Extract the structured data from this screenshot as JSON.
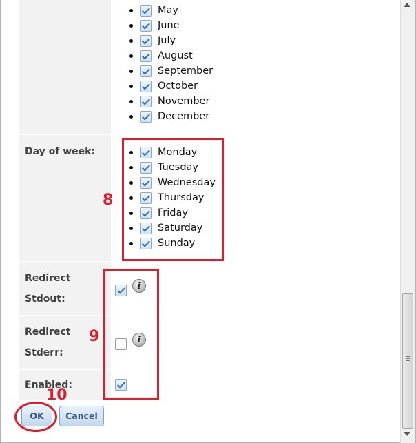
{
  "months": [
    "May",
    "June",
    "July",
    "August",
    "September",
    "October",
    "November",
    "December"
  ],
  "day_of_week": {
    "label": "Day of week:",
    "days": [
      "Monday",
      "Tuesday",
      "Wednesday",
      "Thursday",
      "Friday",
      "Saturday",
      "Sunday"
    ]
  },
  "redirect_stdout": {
    "label_line1": "Redirect",
    "label_line2": "Stdout:",
    "checked": true,
    "icon": "info-icon"
  },
  "redirect_stderr": {
    "label_line1": "Redirect",
    "label_line2": "Stderr:",
    "checked": false,
    "icon": "info-icon"
  },
  "enabled": {
    "label": "Enabled:",
    "checked": true
  },
  "annotations": {
    "days_number": "8",
    "options_number": "9",
    "ok_number": "10",
    "color": "#d9202e"
  },
  "buttons": {
    "ok": "OK",
    "cancel": "Cancel"
  }
}
